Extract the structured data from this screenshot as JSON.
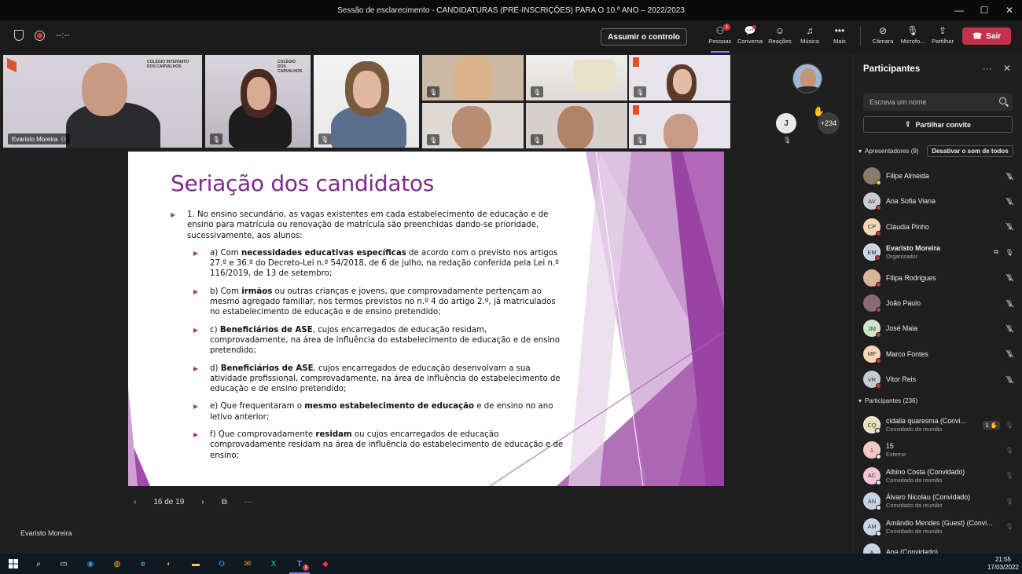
{
  "window": {
    "title": "Sessão de esclarecimento - CANDIDATURAS (PRÉ-INSCRIÇÕES) PARA O 10.º ANO – 2022/2023"
  },
  "toolbar": {
    "timer": "--:--",
    "control_label": "Assumir o controlo",
    "items": [
      {
        "label": "Pessoas",
        "icon": "people-icon",
        "badge": "1"
      },
      {
        "label": "Conversa",
        "icon": "chat-icon"
      },
      {
        "label": "Reações",
        "icon": "reactions-icon"
      },
      {
        "label": "Música",
        "icon": "music-icon"
      },
      {
        "label": "Mais",
        "icon": "more-icon"
      }
    ],
    "device_items": [
      {
        "label": "Câmara",
        "icon": "camera-off-icon"
      },
      {
        "label": "Microfo...",
        "icon": "mic-off-icon"
      },
      {
        "label": "Partilhar",
        "icon": "share-icon"
      }
    ],
    "leave_label": "Sair",
    "leave_color": "#c4314b"
  },
  "videos": {
    "speaker_name": "Evaristo Moreira",
    "school_logo": "COLÉGIO INTERNATO DOS CARVALHOS",
    "school_logo_small": "COLÉGIO DOS CARVALHOS",
    "overflow_initial": "J",
    "overflow_count": "+234"
  },
  "slide": {
    "title": "Seriação dos candidatos",
    "intro": "1. No ensino secundário, as vagas existentes em cada estabelecimento de educação e de ensino para matrícula ou renovação de matrícula são preenchidas dando-se prioridade, sucessivamente, aos alunos:",
    "items": [
      {
        "pre": "a) Com ",
        "bold": "necessidades educativas específicas",
        "post": " de acordo com o previsto nos artigos 27.º e 36.º do Decreto-Lei n.º 54/2018, de 6 de julho, na redação conferida pela Lei n.º 116/2019, de 13 de setembro;"
      },
      {
        "pre": "b) Com ",
        "bold": "irmãos",
        "post": " ou outras crianças e jovens, que comprovadamente pertençam ao mesmo agregado familiar, nos termos previstos no n.º 4 do artigo 2.º, já matriculados no estabelecimento de educação e de ensino pretendido;"
      },
      {
        "pre": "c) ",
        "bold": "Beneficiários de ASE",
        "post": ", cujos encarregados de educação residam, comprovadamente, na área de influência do estabelecimento de educação e de ensino pretendido;"
      },
      {
        "pre": "d) ",
        "bold": "Beneficiários de ASE",
        "post": ", cujos encarregados de educação desenvolvam a sua atividade profissional, comprovadamente, na área de influência do estabelecimento de educação e de ensino pretendido;"
      },
      {
        "pre": "e) Que frequentaram o ",
        "bold": "mesmo estabelecimento de educação",
        "post": " e de ensino no ano letivo anterior;"
      },
      {
        "pre": "f) Que comprovadamente ",
        "bold": "residam",
        "post": " ou cujos encarregados de educação comprovadamente residam na área de influência do estabelecimento de educação e de ensino;"
      }
    ],
    "page_indicator": "16 de 19",
    "presenter_label": "Evaristo Moreira",
    "accent_color": "#7e2a8b"
  },
  "panel": {
    "title": "Participantes",
    "search_placeholder": "Escreva um nome",
    "share_invite": "Partilhar convite",
    "presenters_header": "Apresentadores (9)",
    "mute_all": "Desativar o som de todos",
    "presenters": [
      {
        "name": "Filipe Almeida",
        "initials": "",
        "color": "#8a7a6a",
        "role": "",
        "mic": "off",
        "status": "#f8d22a"
      },
      {
        "name": "Ana Sofia Viana",
        "initials": "AV",
        "color": "#c8ccd2",
        "role": "",
        "mic": "off",
        "status": "#d13438"
      },
      {
        "name": "Cláudia Pinho",
        "initials": "CP",
        "color": "#f4d7b4",
        "role": "",
        "mic": "off",
        "status": "#d13438"
      },
      {
        "name": "Evaristo Moreira",
        "initials": "EM",
        "color": "#c9d3e3",
        "role": "Organizador",
        "mic": "on",
        "status": "#d13438"
      },
      {
        "name": "Filipa Rodrigues",
        "initials": "",
        "color": "#d7b59a",
        "role": "",
        "mic": "off",
        "status": "#d13438"
      },
      {
        "name": "João Paulo",
        "initials": "",
        "color": "#8a6a7a",
        "role": "",
        "mic": "off",
        "status": "#d13438"
      },
      {
        "name": "José Maia",
        "initials": "JM",
        "color": "#cfe3c9",
        "role": "",
        "mic": "off",
        "status": "#d13438"
      },
      {
        "name": "Marco Fontes",
        "initials": "MF",
        "color": "#f4d7b4",
        "role": "",
        "mic": "off",
        "status": "#d13438"
      },
      {
        "name": "Vitor Reis",
        "initials": "VR",
        "color": "#c8ccd2",
        "role": "",
        "mic": "off",
        "status": "#d13438"
      }
    ],
    "participants_header": "Participantes (236)",
    "participants": [
      {
        "name": "cidalia quaresma (Convi...",
        "initials": "CQ",
        "color": "#e8e2b8",
        "role": "Convidado da reunião",
        "hand": "1"
      },
      {
        "name": "15",
        "initials": "1",
        "color": "#f7c7c7",
        "role": "Externo",
        "hand": ""
      },
      {
        "name": "Albino Costa (Convidado)",
        "initials": "AC",
        "color": "#f2c6d4",
        "role": "Convidado da reunião",
        "hand": ""
      },
      {
        "name": "Álvaro Nicolau (Convidado)",
        "initials": "ÁN",
        "color": "#c9d3e3",
        "role": "Convidado da reunião",
        "hand": ""
      },
      {
        "name": "Amândio Mendes (Guest) (Convi...",
        "initials": "AM",
        "color": "#c9d3e3",
        "role": "Convidado da reunião",
        "hand": ""
      },
      {
        "name": "Ana (Convidado)",
        "initials": "A",
        "color": "#c9d3e3",
        "role": "",
        "hand": ""
      }
    ]
  },
  "taskbar": {
    "time": "21:55",
    "date": "17/03/2022",
    "teams_badge": "1"
  }
}
